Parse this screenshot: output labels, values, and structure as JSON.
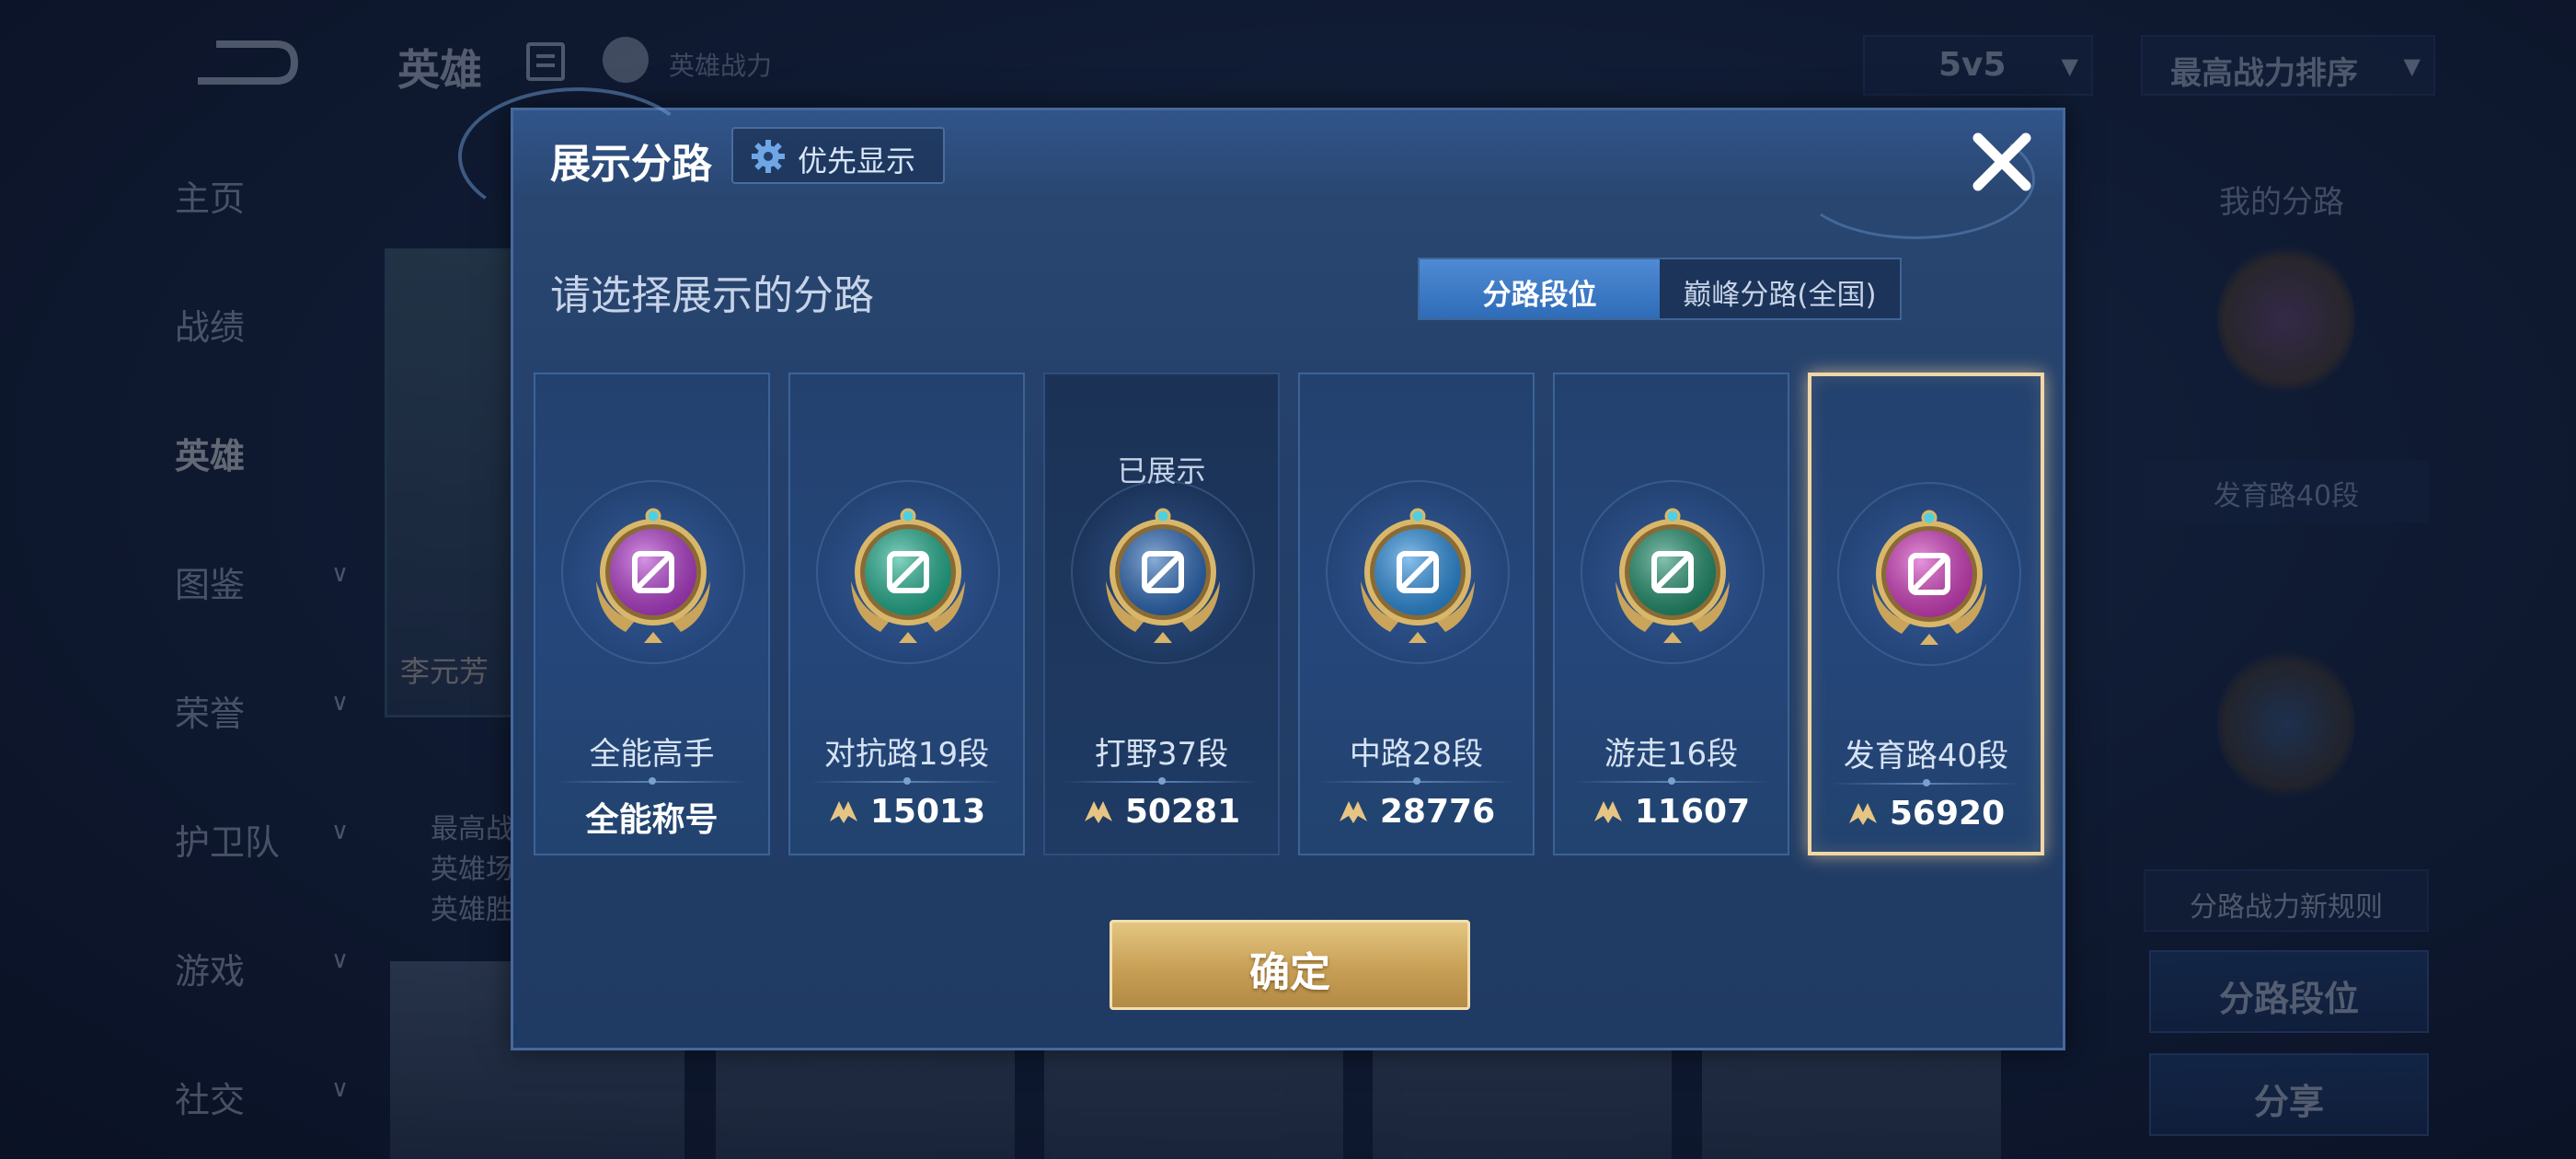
{
  "background": {
    "title": "英雄",
    "power_label": "英雄战力",
    "mode": "5v5",
    "sort": "最高战力排序",
    "nav": [
      {
        "label": "主页",
        "arrow": false
      },
      {
        "label": "战绩",
        "arrow": false
      },
      {
        "label": "英雄",
        "arrow": false,
        "active": true
      },
      {
        "label": "图鉴",
        "arrow": true
      },
      {
        "label": "荣誉",
        "arrow": true
      },
      {
        "label": "护卫队",
        "arrow": true
      },
      {
        "label": "游戏",
        "arrow": true
      },
      {
        "label": "社交",
        "arrow": true
      }
    ],
    "hero_name": "李元芳",
    "hero_stats": [
      "最高战",
      "英雄场",
      "英雄胜"
    ],
    "right_panel": {
      "title": "我的分路",
      "lane": "发育路40段",
      "rule": "分路战力新规则",
      "lane_rank_button": "分路段位",
      "share_button": "分享"
    }
  },
  "modal": {
    "title": "展示分路",
    "priority_label": "优先显示",
    "subtitle": "请选择展示的分路",
    "segments": [
      {
        "label": "分路段位",
        "active": true
      },
      {
        "label": "巅峰分路(全国)",
        "active": false
      }
    ],
    "cards": [
      {
        "name": "全能高手",
        "value": "全能称号",
        "medal_color": "#b43bd0",
        "has_power": false
      },
      {
        "name": "对抗路19段",
        "value": "15013",
        "medal_color": "#1fb08e",
        "has_power": true
      },
      {
        "name": "打野37段",
        "value": "50281",
        "medal_color": "#2a68b8",
        "has_power": true,
        "tag": "已展示"
      },
      {
        "name": "中路28段",
        "value": "28776",
        "medal_color": "#2a8ee0",
        "has_power": true
      },
      {
        "name": "游走16段",
        "value": "11607",
        "medal_color": "#1e8f6c",
        "has_power": true
      },
      {
        "name": "发育路40段",
        "value": "56920",
        "medal_color": "#d43cc0",
        "has_power": true,
        "selected": true
      }
    ],
    "confirm_label": "确定"
  },
  "colors": {
    "gold": "#e3c682",
    "selected_border": "#f1d7a6",
    "segment_active": "#3a7ac6"
  }
}
